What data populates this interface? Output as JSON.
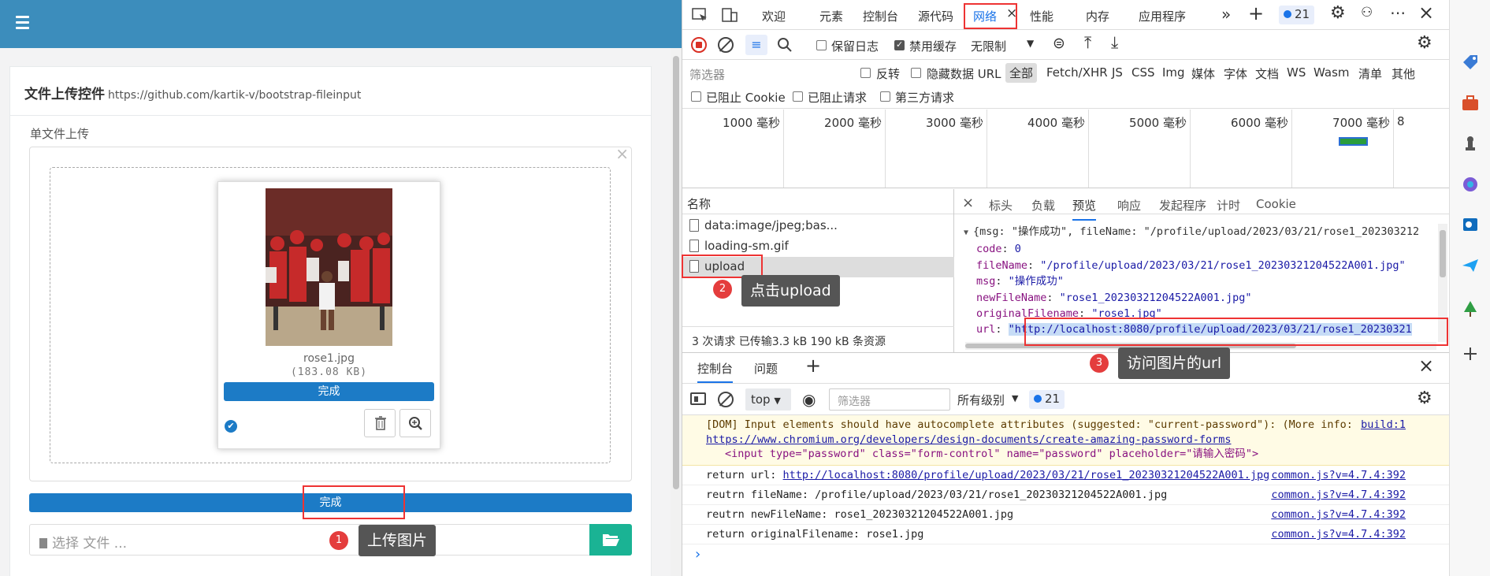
{
  "app": {
    "card_title": "文件上传控件",
    "card_subtitle": "https://github.com/kartik-v/bootstrap-fileinput",
    "section_label": "单文件上传",
    "close_glyph": "×",
    "thumb": {
      "filename": "rose1.jpg",
      "size": "(183.08 KB)",
      "progress_label": "完成"
    },
    "main_progress_label": "完成",
    "file_input_placeholder": "选择 文件 ..."
  },
  "annotations": [
    {
      "num": "1",
      "text": "上传图片"
    },
    {
      "num": "2",
      "text": "点击upload"
    },
    {
      "num": "3",
      "text": "访问图片的url"
    }
  ],
  "devtools": {
    "tabs": [
      "欢迎",
      "元素",
      "控制台",
      "源代码",
      "网络",
      "性能",
      "内存",
      "应用程序"
    ],
    "active_tab": "网络",
    "issue_count": "21",
    "toolbar": {
      "preserve_log": "保留日志",
      "disable_cache": "禁用缓存",
      "throttle": "无限制"
    },
    "filter": {
      "placeholder": "筛选器",
      "invert": "反转",
      "hide_data_url": "隐藏数据 URL",
      "types": [
        "全部",
        "Fetch/XHR",
        "JS",
        "CSS",
        "Img",
        "媒体",
        "字体",
        "文档",
        "WS",
        "Wasm",
        "清单",
        "其他"
      ],
      "blocked_cookie": "已阻止 Cookie",
      "blocked_requests": "已阻止请求",
      "third_party": "第三方请求"
    },
    "timeline_labels": [
      "1000 毫秒",
      "2000 毫秒",
      "3000 毫秒",
      "4000 毫秒",
      "5000 毫秒",
      "6000 毫秒",
      "7000 毫秒",
      "8"
    ],
    "requests_header": "名称",
    "requests": [
      "data:image/jpeg;bas...",
      "loading-sm.gif",
      "upload"
    ],
    "requests_footer": "3 次请求  已传输3.3 kB  190 kB 条资源",
    "preview_tabs": [
      "标头",
      "负载",
      "预览",
      "响应",
      "发起程序",
      "计时",
      "Cookie"
    ],
    "active_preview_tab": "预览",
    "json": {
      "summary": "{msg: \"操作成功\", fileName: \"/profile/upload/2023/03/21/rose1_202303212",
      "rows": [
        {
          "key": "code",
          "value": "0"
        },
        {
          "key": "fileName",
          "value": "\"/profile/upload/2023/03/21/rose1_20230321204522A001.jpg\""
        },
        {
          "key": "msg",
          "value": "\"操作成功\""
        },
        {
          "key": "newFileName",
          "value": "\"rose1_20230321204522A001.jpg\""
        },
        {
          "key": "originalFilename",
          "value": "\"rose1.jpg\""
        },
        {
          "key": "url",
          "value": "\"http://localhost:8080/profile/upload/2023/03/21/rose1_20230321"
        }
      ]
    },
    "drawer_tabs": [
      "控制台",
      "问题"
    ],
    "console_toolbar": {
      "context": "top",
      "filter_placeholder": "筛选器",
      "levels": "所有级别",
      "issues": "21"
    },
    "console": {
      "warn_line1": "[DOM] Input elements should have autocomplete attributes (suggested: \"current-password\"): (More info: ",
      "warn_source": "build:1",
      "warn_link": "https://www.chromium.org/developers/design-documents/create-amazing-password-forms",
      "warn_line3": "<input type=\"password\" class=\"form-control\" name=\"password\" placeholder=\"请输入密码\">",
      "logs": [
        {
          "text": "return url: ",
          "link": "http://localhost:8080/profile/upload/2023/03/21/rose1_20230321204522A001.jpg",
          "source": "common.js?v=4.7.4:392"
        },
        {
          "text": "reutrn fileName: /profile/upload/2023/03/21/rose1_20230321204522A001.jpg",
          "link": "",
          "source": "common.js?v=4.7.4:392"
        },
        {
          "text": "reutrn newFileName: rose1_20230321204522A001.jpg",
          "link": "",
          "source": "common.js?v=4.7.4:392"
        },
        {
          "text": "return originalFilename: rose1.jpg",
          "link": "",
          "source": "common.js?v=4.7.4:392"
        }
      ],
      "prompt": "›"
    }
  },
  "colors": {
    "topbar": "#3c8dbc",
    "progress": "#1c7bc6",
    "browse": "#1ab394",
    "annotation_red": "#e33333"
  }
}
